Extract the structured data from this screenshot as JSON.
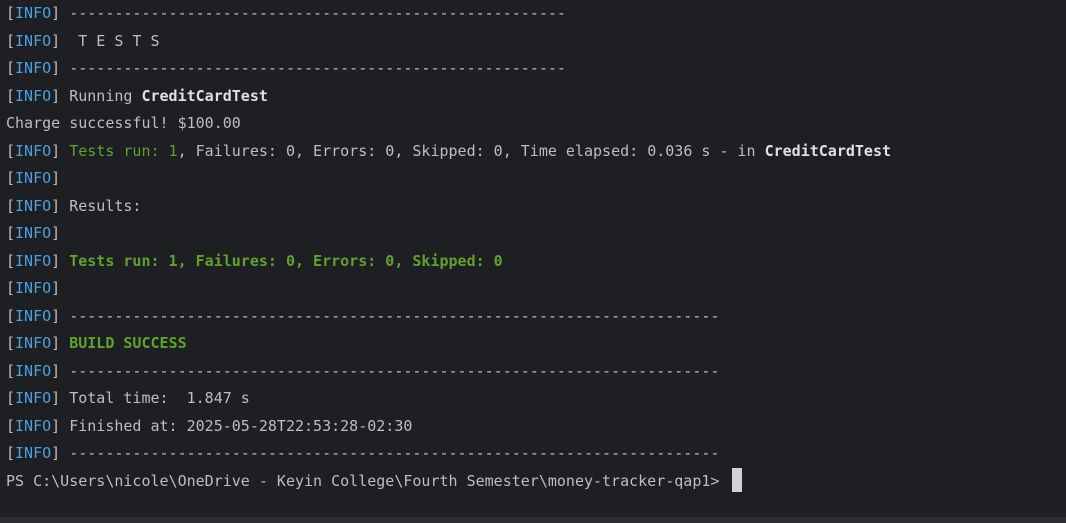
{
  "terminal": {
    "info_tag_open": "[",
    "info_tag_level": "INFO",
    "info_tag_close": "]",
    "dashes_short": "-------------------------------------------------------",
    "dashes_long": "------------------------------------------------------------------------",
    "tests_banner": " T E S T S",
    "running_prefix": "Running ",
    "running_class": "CreditCardTest",
    "charge_output": "Charge successful! $100.00",
    "test_line": {
      "tests_run_label": "Tests run: 1",
      "rest": ", Failures: 0, Errors: 0, Skipped: 0, Time elapsed: 0.036 s - in ",
      "class_name": "CreditCardTest"
    },
    "results_label": "Results:",
    "summary": "Tests run: 1, Failures: 0, Errors: 0, Skipped: 0",
    "build_status": "BUILD SUCCESS",
    "total_time": "Total time:  1.847 s",
    "finished_at": "Finished at: 2025-05-28T22:53:28-02:30",
    "prompt": "PS C:\\Users\\nicole\\OneDrive - Keyin College\\Fourth Semester\\money-tracker-qap1> "
  },
  "colors": {
    "background": "#1e1f22",
    "text": "#bcbec4",
    "info_blue": "#4e9fde",
    "success_green": "#5fa32e"
  }
}
